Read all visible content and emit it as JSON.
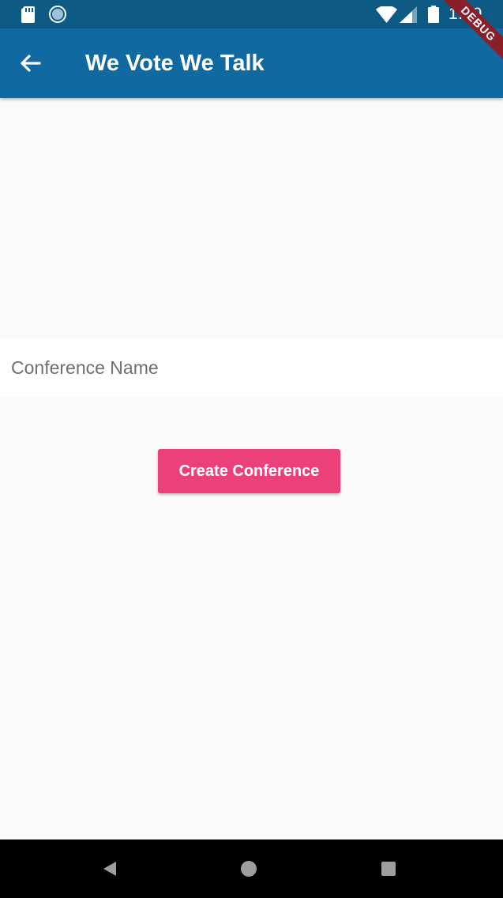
{
  "status_bar": {
    "time": "1:49",
    "icons": [
      "sd-card-icon",
      "sync-icon",
      "wifi-icon",
      "cell-signal-icon",
      "battery-icon"
    ]
  },
  "app_bar": {
    "title": "We Vote We Talk",
    "back_icon": "arrow-back-icon",
    "background": "#1069a0"
  },
  "debug_banner": {
    "label": "DEBUG"
  },
  "form": {
    "conference_name": {
      "value": "",
      "placeholder": "Conference Name"
    },
    "create_button_label": "Create Conference",
    "button_color": "#ec407a"
  },
  "nav_bar": {
    "buttons": [
      "back-triangle-icon",
      "home-circle-icon",
      "recents-square-icon"
    ]
  }
}
